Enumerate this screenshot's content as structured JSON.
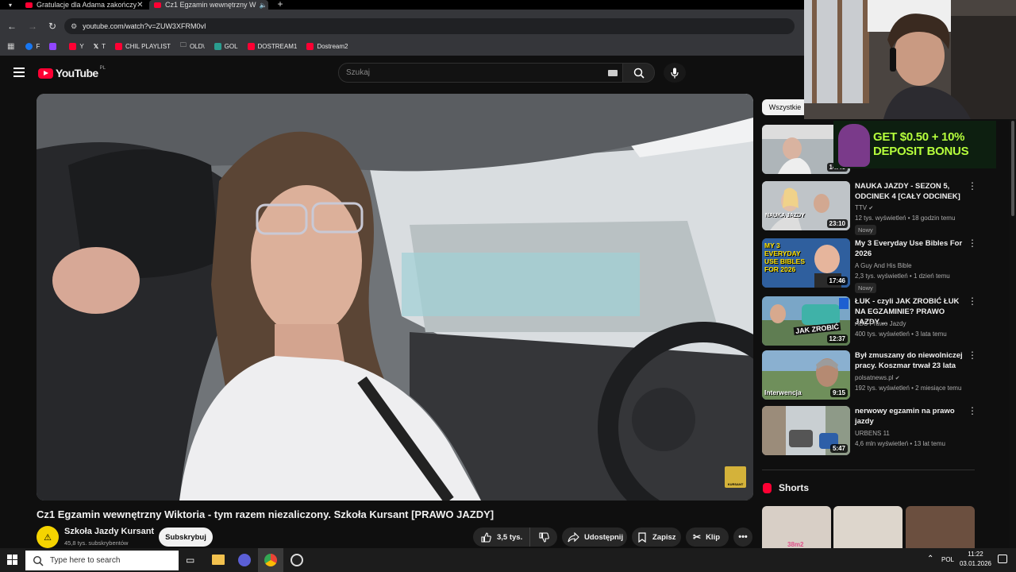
{
  "browser": {
    "tabs": [
      {
        "label": "Gratulacje dla Adama zakończy"
      },
      {
        "label": "Cz1 Egzamin wewnętrzny W"
      }
    ],
    "url": "youtube.com/watch?v=ZUW3XFRM0vI",
    "bookmarks": [
      {
        "label": "F"
      },
      {
        "label": ""
      },
      {
        "label": "Y"
      },
      {
        "label": "T"
      },
      {
        "label": "CHIL PLAYLIST"
      },
      {
        "label": "OLD\\"
      },
      {
        "label": "GOL"
      },
      {
        "label": "DOSTREAM1"
      },
      {
        "label": "Dostream2"
      }
    ]
  },
  "youtube": {
    "logo_text": "YouTube",
    "region": "PL",
    "search_placeholder": "Szukaj",
    "filter_chip": "Wszystkie"
  },
  "video": {
    "title": "Cz1 Egzamin wewnętrzny Wiktoria - tym razem niezaliczony. Szkoła Kursant [PRAWO JAZDY]",
    "channel": "Szkoła Jazdy Kursant",
    "subscribers": "45,8 tys. subskrybentów",
    "subscribe_label": "Subskrybuj",
    "likes": "3,5 tys.",
    "share_label": "Udostępnij",
    "save_label": "Zapisz",
    "clip_label": "Klip",
    "watermark_text": "KURSANT"
  },
  "ad": {
    "line1": "GET $0.50 + 10%",
    "line2": "DEPOSIT BONUS",
    "duration": "14:46"
  },
  "recommendations": [
    {
      "title": "NAUKA JAZDY - SEZON 5, ODCINEK 4 [CAŁY ODCINEK]",
      "channel": "TTV",
      "meta": "12 tys. wyświetleń • 18 godzin temu",
      "badge": "Nowy",
      "duration": "23:10",
      "thumb_text": "NAUKA JAZDY"
    },
    {
      "title": "My 3 Everyday Use Bibles For 2026",
      "channel": "A Guy And His Bible",
      "meta": "2,3 tys. wyświetleń • 1 dzień temu",
      "badge": "Nowy",
      "duration": "17:46",
      "thumb_text": "MY 3 EVERYDAY USE BIBLES FOR 2026"
    },
    {
      "title": "ŁUK - czyli JAK ZROBIĆ ŁUK NA EGZAMINIE? PRAWO JAZDY ...",
      "channel": "ABC Prawo Jazdy",
      "meta": "400 tys. wyświetleń • 3 lata temu",
      "badge": "",
      "duration": "12:37",
      "thumb_text": "JAK ZROBIĆ"
    },
    {
      "title": "Był zmuszany do niewolniczej pracy. Koszmar trwał 23 lata",
      "channel": "polsatnews.pl",
      "meta": "192 tys. wyświetleń • 2 miesiące temu",
      "badge": "",
      "duration": "9:15",
      "thumb_text": "Interwencja"
    },
    {
      "title": "nerwowy egzamin na prawo jazdy",
      "channel": "URBENS 11",
      "meta": "4,6 mln wyświetleń • 13 lat temu",
      "badge": "",
      "duration": "5:47",
      "thumb_text": ""
    }
  ],
  "shorts": {
    "header": "Shorts",
    "first_overlay": "38m2"
  },
  "taskbar": {
    "search_placeholder": "Type here to search",
    "language": "POL",
    "time": "11:22",
    "date": "03.01.2026"
  },
  "colors": {
    "youtube_red": "#ff0033",
    "background": "#0f0f0f",
    "ad_green": "#b6ff3c"
  }
}
